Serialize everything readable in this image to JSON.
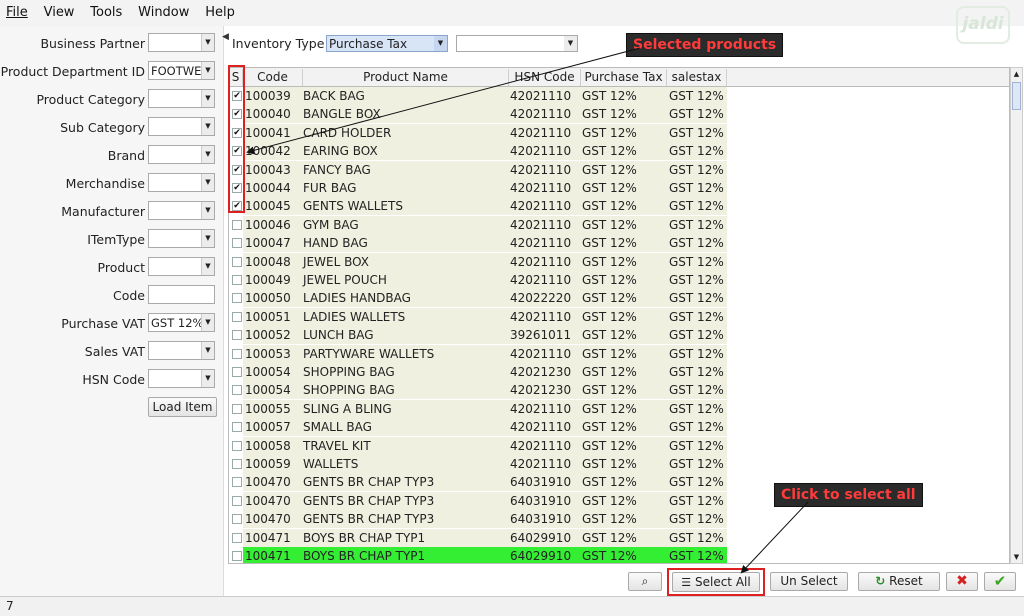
{
  "menu": [
    "File",
    "View",
    "Tools",
    "Window",
    "Help"
  ],
  "logo_text": "jaldi",
  "filters": [
    {
      "label": "Business Partner",
      "type": "combo",
      "value": ""
    },
    {
      "label": "Product Department ID",
      "type": "combo",
      "value": "FOOTWEAR"
    },
    {
      "label": "Product Category",
      "type": "combo",
      "value": ""
    },
    {
      "label": "Sub Category",
      "type": "combo",
      "value": ""
    },
    {
      "label": "Brand",
      "type": "combo",
      "value": ""
    },
    {
      "label": "Merchandise",
      "type": "combo",
      "value": ""
    },
    {
      "label": "Manufacturer",
      "type": "combo",
      "value": ""
    },
    {
      "label": "ITemType",
      "type": "combo",
      "value": ""
    },
    {
      "label": "Product",
      "type": "combo",
      "value": ""
    },
    {
      "label": "Code",
      "type": "text",
      "value": ""
    },
    {
      "label": "Purchase VAT",
      "type": "combo",
      "value": "GST 12%"
    },
    {
      "label": "Sales VAT",
      "type": "combo",
      "value": ""
    },
    {
      "label": "HSN Code",
      "type": "combo",
      "value": ""
    }
  ],
  "load_item_label": "Load Item",
  "inventory": {
    "label": "Inventory Type",
    "value": "Purchase Tax",
    "second_value": ""
  },
  "columns": [
    "S",
    "Code",
    "Product Name",
    "HSN Code",
    "Purchase Tax",
    "salestax"
  ],
  "rows": [
    {
      "checked": true,
      "code": "100039",
      "name": "BACK BAG",
      "hsn": "42021110",
      "ptax": "GST 12%",
      "stax": "GST 12%"
    },
    {
      "checked": true,
      "code": "100040",
      "name": "BANGLE BOX",
      "hsn": "42021110",
      "ptax": "GST 12%",
      "stax": "GST 12%"
    },
    {
      "checked": true,
      "code": "100041",
      "name": "CARD HOLDER",
      "hsn": "42021110",
      "ptax": "GST 12%",
      "stax": "GST 12%"
    },
    {
      "checked": true,
      "code": "100042",
      "name": "EARING BOX",
      "hsn": "42021110",
      "ptax": "GST 12%",
      "stax": "GST 12%"
    },
    {
      "checked": true,
      "code": "100043",
      "name": "FANCY BAG",
      "hsn": "42021110",
      "ptax": "GST 12%",
      "stax": "GST 12%"
    },
    {
      "checked": true,
      "code": "100044",
      "name": "FUR BAG",
      "hsn": "42021110",
      "ptax": "GST 12%",
      "stax": "GST 12%"
    },
    {
      "checked": true,
      "code": "100045",
      "name": "GENTS WALLETS",
      "hsn": "42021110",
      "ptax": "GST 12%",
      "stax": "GST 12%"
    },
    {
      "checked": false,
      "code": "100046",
      "name": "GYM BAG",
      "hsn": "42021110",
      "ptax": "GST 12%",
      "stax": "GST 12%"
    },
    {
      "checked": false,
      "code": "100047",
      "name": "HAND BAG",
      "hsn": "42021110",
      "ptax": "GST 12%",
      "stax": "GST 12%"
    },
    {
      "checked": false,
      "code": "100048",
      "name": "JEWEL BOX",
      "hsn": "42021110",
      "ptax": "GST 12%",
      "stax": "GST 12%"
    },
    {
      "checked": false,
      "code": "100049",
      "name": "JEWEL POUCH",
      "hsn": "42021110",
      "ptax": "GST 12%",
      "stax": "GST 12%"
    },
    {
      "checked": false,
      "code": "100050",
      "name": "LADIES HANDBAG",
      "hsn": "42022220",
      "ptax": "GST 12%",
      "stax": "GST 12%"
    },
    {
      "checked": false,
      "code": "100051",
      "name": "LADIES WALLETS",
      "hsn": "42021110",
      "ptax": "GST 12%",
      "stax": "GST 12%"
    },
    {
      "checked": false,
      "code": "100052",
      "name": "LUNCH BAG",
      "hsn": "39261011",
      "ptax": "GST 12%",
      "stax": "GST 12%"
    },
    {
      "checked": false,
      "code": "100053",
      "name": "PARTYWARE WALLETS",
      "hsn": "42021110",
      "ptax": "GST 12%",
      "stax": "GST 12%"
    },
    {
      "checked": false,
      "code": "100054",
      "name": "SHOPPING BAG",
      "hsn": "42021230",
      "ptax": "GST 12%",
      "stax": "GST 12%"
    },
    {
      "checked": false,
      "code": "100054",
      "name": "SHOPPING BAG",
      "hsn": "42021230",
      "ptax": "GST 12%",
      "stax": "GST 12%"
    },
    {
      "checked": false,
      "code": "100055",
      "name": "SLING A BLING",
      "hsn": "42021110",
      "ptax": "GST 12%",
      "stax": "GST 12%"
    },
    {
      "checked": false,
      "code": "100057",
      "name": "SMALL BAG",
      "hsn": "42021110",
      "ptax": "GST 12%",
      "stax": "GST 12%"
    },
    {
      "checked": false,
      "code": "100058",
      "name": "TRAVEL KIT",
      "hsn": "42021110",
      "ptax": "GST 12%",
      "stax": "GST 12%"
    },
    {
      "checked": false,
      "code": "100059",
      "name": "WALLETS",
      "hsn": "42021110",
      "ptax": "GST 12%",
      "stax": "GST 12%"
    },
    {
      "checked": false,
      "code": "100470",
      "name": "GENTS BR CHAP TYP3",
      "hsn": "64031910",
      "ptax": "GST 12%",
      "stax": "GST 12%"
    },
    {
      "checked": false,
      "code": "100470",
      "name": "GENTS BR CHAP TYP3",
      "hsn": "64031910",
      "ptax": "GST 12%",
      "stax": "GST 12%"
    },
    {
      "checked": false,
      "code": "100470",
      "name": "GENTS BR CHAP TYP3",
      "hsn": "64031910",
      "ptax": "GST 12%",
      "stax": "GST 12%"
    },
    {
      "checked": false,
      "code": "100471",
      "name": "BOYS BR CHAP TYP1",
      "hsn": "64029910",
      "ptax": "GST 12%",
      "stax": "GST 12%"
    },
    {
      "checked": false,
      "code": "100471",
      "name": "BOYS BR CHAP TYP1",
      "hsn": "64029910",
      "ptax": "GST 12%",
      "stax": "GST 12%",
      "highlight": true
    }
  ],
  "buttons": {
    "select_all": "Select All",
    "un_select": "Un Select",
    "reset": "Reset"
  },
  "annotations": {
    "selected_products": "Selected products",
    "click_select_all": "Click to select all"
  },
  "status_text": "7",
  "colors": {
    "highlight_row": "#33ee33",
    "annotation_text": "#ff3b3b",
    "annotation_border": "#e02020"
  }
}
